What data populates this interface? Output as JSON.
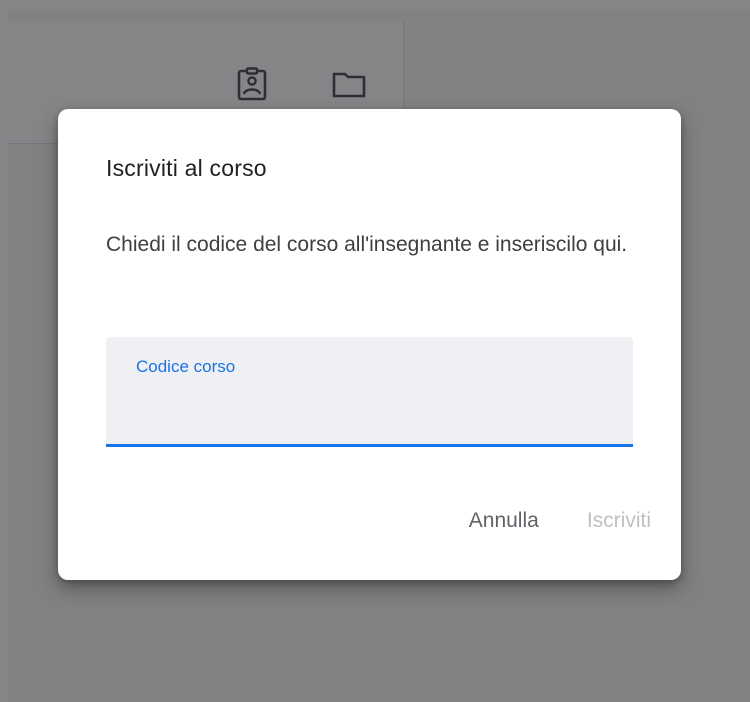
{
  "background": {
    "icons": [
      "assignment-ind-icon",
      "folder-icon"
    ]
  },
  "dialog": {
    "title": "Iscriviti al corso",
    "body": "Chiedi il codice del corso all'insegnante e inseriscilo qui.",
    "field": {
      "label": "Codice corso",
      "value": ""
    },
    "actions": {
      "cancel_label": "Annulla",
      "submit_label": "Iscriviti"
    }
  },
  "colors": {
    "accent": "#1a73e8",
    "scrim": "#202124",
    "disabled_text": "#bdc1c6"
  }
}
